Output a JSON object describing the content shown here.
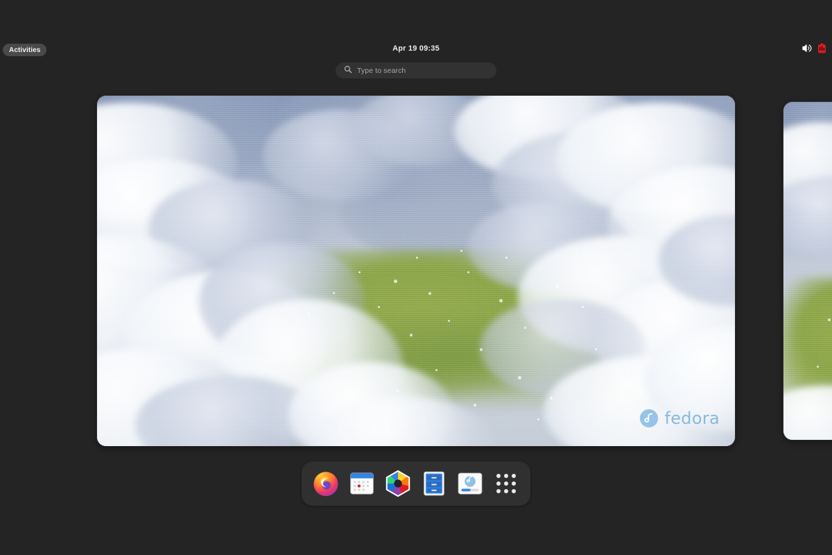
{
  "desktop": {
    "environment": "GNOME Shell Activities Overview",
    "background_color": "#242424"
  },
  "topbar": {
    "activities_label": "Activities",
    "clock": "Apr 19  09:35",
    "status_icons": [
      {
        "name": "volume-icon",
        "label": "Volume",
        "color": "#ffffff"
      },
      {
        "name": "battery-icon",
        "label": "Battery low",
        "color": "#e01b24"
      }
    ]
  },
  "search": {
    "placeholder": "Type to search",
    "value": "",
    "icon": "search-icon"
  },
  "workspaces": {
    "active_index": 0,
    "items": [
      {
        "name": "workspace-1",
        "label": "Workspace 1",
        "selected": true
      },
      {
        "name": "workspace-2",
        "label": "Workspace 2",
        "selected": false
      }
    ],
    "wallpaper": {
      "name": "Fedora clouds wallpaper",
      "watermark_text": "fedora",
      "watermark_color": "#7fb5e0"
    }
  },
  "dock": {
    "items": [
      {
        "name": "dock-item-firefox",
        "label": "Firefox"
      },
      {
        "name": "dock-item-calendar",
        "label": "Calendar"
      },
      {
        "name": "dock-item-photos",
        "label": "Photos"
      },
      {
        "name": "dock-item-files",
        "label": "Files"
      },
      {
        "name": "dock-item-software",
        "label": "Software"
      }
    ],
    "show_apps_label": "Show Applications"
  }
}
